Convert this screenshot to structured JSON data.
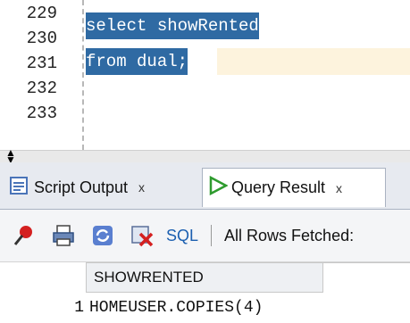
{
  "editor": {
    "line_numbers": [
      "229",
      "230",
      "231",
      "232",
      "233"
    ],
    "lines": [
      {
        "text": "select showRented"
      },
      {
        "text": "from dual;"
      }
    ]
  },
  "tabs": [
    {
      "label": "Script Output",
      "close": "x",
      "active": false
    },
    {
      "label": "Query Result",
      "close": "x",
      "active": true
    }
  ],
  "toolbar": {
    "icons": [
      "pin-icon",
      "print-icon",
      "refresh-icon",
      "cancel-icon"
    ],
    "sql_label": "SQL",
    "separator": "|",
    "status": "All Rows Fetched:"
  },
  "grid": {
    "columns": [
      "SHOWRENTED"
    ],
    "rows": [
      {
        "row_number": "1",
        "values": [
          "HOMEUSER.COPIES(4)"
        ]
      }
    ]
  },
  "colors": {
    "selection": "#2f6aa3",
    "cursor_line": "#fdf3dd",
    "sql_link": "#1b5fb0",
    "tab_bar": "#e7eaf0"
  }
}
